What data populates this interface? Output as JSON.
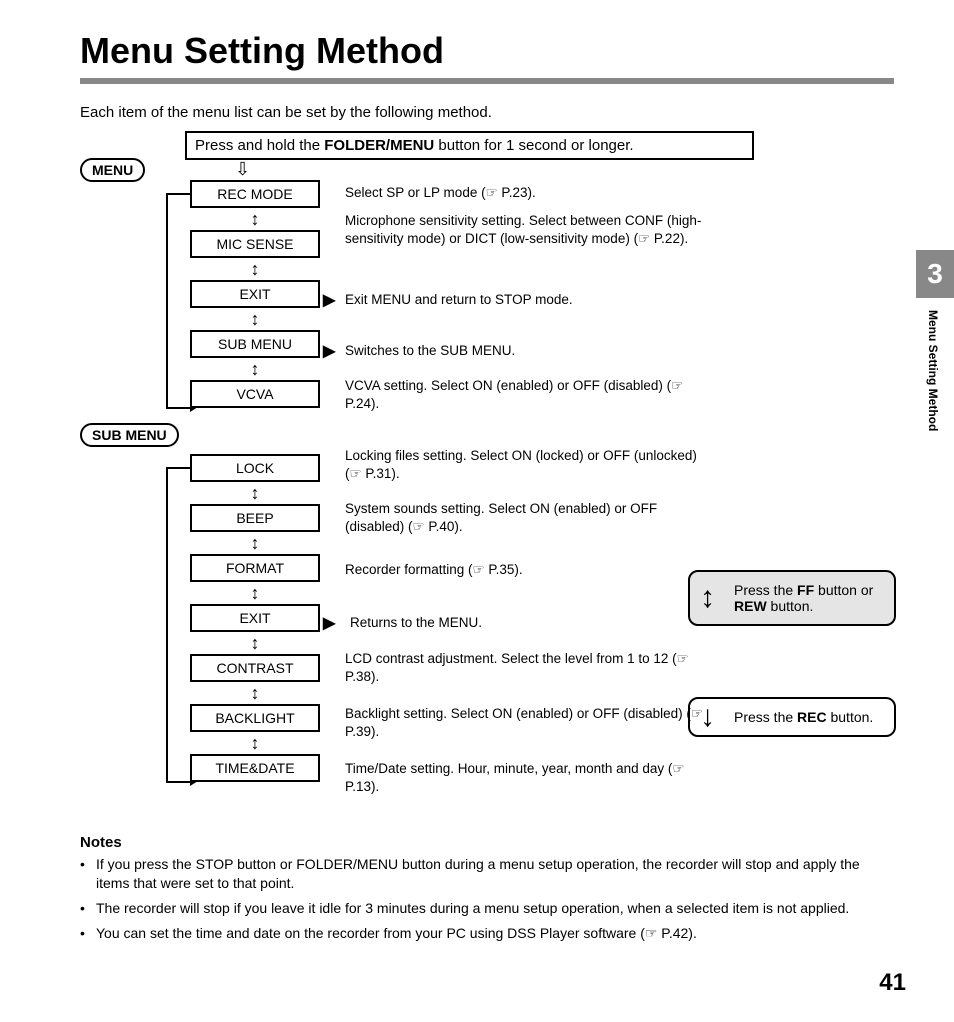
{
  "title": "Menu Setting Method",
  "intro": "Each item of the menu list can be set by the following method.",
  "step_prefix": "Press and hold the ",
  "step_bold": "FOLDER/MENU",
  "step_suffix": " button for 1 second or longer.",
  "menu_label": "MENU",
  "submenu_label": "SUB MENU",
  "menu_items": {
    "rec_mode": {
      "label": "REC MODE",
      "desc": "Select SP or LP mode (☞ P.23)."
    },
    "mic_sense": {
      "label": "MIC SENSE",
      "desc": "Microphone sensitivity setting. Select between CONF (high-sensitivity mode) or DICT (low-sensitivity mode) (☞ P.22)."
    },
    "exit": {
      "label": "EXIT",
      "desc": "Exit MENU and return to STOP mode."
    },
    "sub_menu": {
      "label": "SUB MENU",
      "desc": "Switches to the SUB MENU."
    },
    "vcva": {
      "label": "VCVA",
      "desc": "VCVA setting. Select ON (enabled) or OFF (disabled) (☞ P.24)."
    }
  },
  "submenu_items": {
    "lock": {
      "label": "LOCK",
      "desc": "Locking files setting. Select ON (locked) or OFF (unlocked) (☞ P.31)."
    },
    "beep": {
      "label": "BEEP",
      "desc": "System sounds setting. Select ON (enabled) or OFF (disabled) (☞ P.40)."
    },
    "format": {
      "label": "FORMAT",
      "desc": "Recorder formatting (☞ P.35)."
    },
    "exit": {
      "label": "EXIT",
      "desc": "Returns to the MENU."
    },
    "contrast": {
      "label": "CONTRAST",
      "desc": "LCD contrast adjustment. Select the level from 1 to 12 (☞ P.38)."
    },
    "backlight": {
      "label": "BACKLIGHT",
      "desc": "Backlight setting. Select ON (enabled) or OFF (disabled) (☞ P.39)."
    },
    "timedate": {
      "label": "TIME&DATE",
      "desc": "Time/Date setting. Hour, minute, year, month and day (☞ P.13)."
    }
  },
  "hint_nav": {
    "pre": "Press the ",
    "b1": "FF",
    "mid": " button or ",
    "b2": "REW",
    "post": " button."
  },
  "hint_rec": {
    "pre": "Press the ",
    "b1": "REC",
    "post": " button."
  },
  "notes_hd": "Notes",
  "notes": [
    "If you press the STOP button or FOLDER/MENU button during a menu setup operation, the recorder will stop and apply the items that were set to that point.",
    "The recorder will stop if you leave it idle for 3 minutes during a menu setup operation, when a selected item is not applied.",
    "You can set the time and date on the recorder from your PC using DSS Player software (☞ P.42)."
  ],
  "section_number": "3",
  "side_title": "Menu Setting Method",
  "page_number": "41"
}
